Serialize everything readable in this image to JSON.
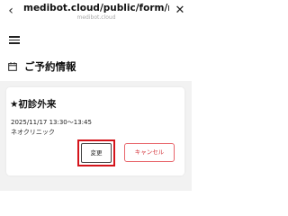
{
  "browser": {
    "title": "medibot.cloud/public/form/myp...",
    "subtitle": "medibot.cloud",
    "back_icon": "chevron-left-icon",
    "close_icon": "close-icon"
  },
  "nav": {
    "menu_icon": "hamburger-menu-icon"
  },
  "page": {
    "title": "ご予約情報",
    "title_icon": "calendar-icon"
  },
  "reservation": {
    "visit_type": "★初診外来",
    "datetime": "2025/11/17 13:30〜13:45",
    "clinic": "ネオクリニック",
    "change_label": "変更",
    "cancel_label": "キャンセル"
  },
  "colors": {
    "accent_red": "#d4141b",
    "cancel_border": "#e8646a",
    "content_background": "#f2f2f2"
  }
}
